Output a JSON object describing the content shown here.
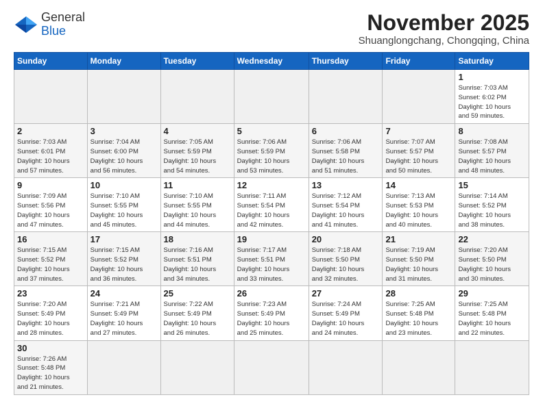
{
  "header": {
    "logo_general": "General",
    "logo_blue": "Blue",
    "month_title": "November 2025",
    "location": "Shuanglongchang, Chongqing, China"
  },
  "days_of_week": [
    "Sunday",
    "Monday",
    "Tuesday",
    "Wednesday",
    "Thursday",
    "Friday",
    "Saturday"
  ],
  "weeks": [
    [
      {
        "day": "",
        "info": ""
      },
      {
        "day": "",
        "info": ""
      },
      {
        "day": "",
        "info": ""
      },
      {
        "day": "",
        "info": ""
      },
      {
        "day": "",
        "info": ""
      },
      {
        "day": "",
        "info": ""
      },
      {
        "day": "1",
        "info": "Sunrise: 7:03 AM\nSunset: 6:02 PM\nDaylight: 10 hours\nand 59 minutes."
      }
    ],
    [
      {
        "day": "2",
        "info": "Sunrise: 7:03 AM\nSunset: 6:01 PM\nDaylight: 10 hours\nand 57 minutes."
      },
      {
        "day": "3",
        "info": "Sunrise: 7:04 AM\nSunset: 6:00 PM\nDaylight: 10 hours\nand 56 minutes."
      },
      {
        "day": "4",
        "info": "Sunrise: 7:05 AM\nSunset: 5:59 PM\nDaylight: 10 hours\nand 54 minutes."
      },
      {
        "day": "5",
        "info": "Sunrise: 7:06 AM\nSunset: 5:59 PM\nDaylight: 10 hours\nand 53 minutes."
      },
      {
        "day": "6",
        "info": "Sunrise: 7:06 AM\nSunset: 5:58 PM\nDaylight: 10 hours\nand 51 minutes."
      },
      {
        "day": "7",
        "info": "Sunrise: 7:07 AM\nSunset: 5:57 PM\nDaylight: 10 hours\nand 50 minutes."
      },
      {
        "day": "8",
        "info": "Sunrise: 7:08 AM\nSunset: 5:57 PM\nDaylight: 10 hours\nand 48 minutes."
      }
    ],
    [
      {
        "day": "9",
        "info": "Sunrise: 7:09 AM\nSunset: 5:56 PM\nDaylight: 10 hours\nand 47 minutes."
      },
      {
        "day": "10",
        "info": "Sunrise: 7:10 AM\nSunset: 5:55 PM\nDaylight: 10 hours\nand 45 minutes."
      },
      {
        "day": "11",
        "info": "Sunrise: 7:10 AM\nSunset: 5:55 PM\nDaylight: 10 hours\nand 44 minutes."
      },
      {
        "day": "12",
        "info": "Sunrise: 7:11 AM\nSunset: 5:54 PM\nDaylight: 10 hours\nand 42 minutes."
      },
      {
        "day": "13",
        "info": "Sunrise: 7:12 AM\nSunset: 5:54 PM\nDaylight: 10 hours\nand 41 minutes."
      },
      {
        "day": "14",
        "info": "Sunrise: 7:13 AM\nSunset: 5:53 PM\nDaylight: 10 hours\nand 40 minutes."
      },
      {
        "day": "15",
        "info": "Sunrise: 7:14 AM\nSunset: 5:52 PM\nDaylight: 10 hours\nand 38 minutes."
      }
    ],
    [
      {
        "day": "16",
        "info": "Sunrise: 7:15 AM\nSunset: 5:52 PM\nDaylight: 10 hours\nand 37 minutes."
      },
      {
        "day": "17",
        "info": "Sunrise: 7:15 AM\nSunset: 5:52 PM\nDaylight: 10 hours\nand 36 minutes."
      },
      {
        "day": "18",
        "info": "Sunrise: 7:16 AM\nSunset: 5:51 PM\nDaylight: 10 hours\nand 34 minutes."
      },
      {
        "day": "19",
        "info": "Sunrise: 7:17 AM\nSunset: 5:51 PM\nDaylight: 10 hours\nand 33 minutes."
      },
      {
        "day": "20",
        "info": "Sunrise: 7:18 AM\nSunset: 5:50 PM\nDaylight: 10 hours\nand 32 minutes."
      },
      {
        "day": "21",
        "info": "Sunrise: 7:19 AM\nSunset: 5:50 PM\nDaylight: 10 hours\nand 31 minutes."
      },
      {
        "day": "22",
        "info": "Sunrise: 7:20 AM\nSunset: 5:50 PM\nDaylight: 10 hours\nand 30 minutes."
      }
    ],
    [
      {
        "day": "23",
        "info": "Sunrise: 7:20 AM\nSunset: 5:49 PM\nDaylight: 10 hours\nand 28 minutes."
      },
      {
        "day": "24",
        "info": "Sunrise: 7:21 AM\nSunset: 5:49 PM\nDaylight: 10 hours\nand 27 minutes."
      },
      {
        "day": "25",
        "info": "Sunrise: 7:22 AM\nSunset: 5:49 PM\nDaylight: 10 hours\nand 26 minutes."
      },
      {
        "day": "26",
        "info": "Sunrise: 7:23 AM\nSunset: 5:49 PM\nDaylight: 10 hours\nand 25 minutes."
      },
      {
        "day": "27",
        "info": "Sunrise: 7:24 AM\nSunset: 5:49 PM\nDaylight: 10 hours\nand 24 minutes."
      },
      {
        "day": "28",
        "info": "Sunrise: 7:25 AM\nSunset: 5:48 PM\nDaylight: 10 hours\nand 23 minutes."
      },
      {
        "day": "29",
        "info": "Sunrise: 7:25 AM\nSunset: 5:48 PM\nDaylight: 10 hours\nand 22 minutes."
      }
    ],
    [
      {
        "day": "30",
        "info": "Sunrise: 7:26 AM\nSunset: 5:48 PM\nDaylight: 10 hours\nand 21 minutes."
      },
      {
        "day": "",
        "info": ""
      },
      {
        "day": "",
        "info": ""
      },
      {
        "day": "",
        "info": ""
      },
      {
        "day": "",
        "info": ""
      },
      {
        "day": "",
        "info": ""
      },
      {
        "day": "",
        "info": ""
      }
    ]
  ]
}
